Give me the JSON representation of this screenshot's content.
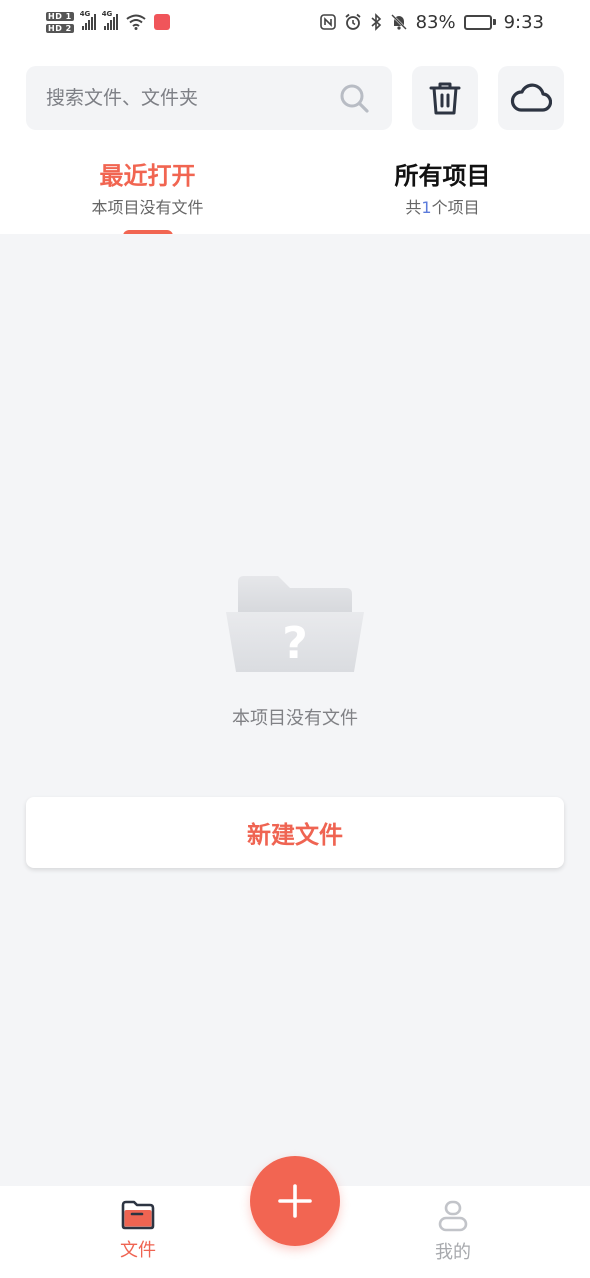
{
  "status_bar": {
    "hd1": "HD 1",
    "hd2": "HD 2",
    "net1": "4G",
    "net2": "4G",
    "battery_percent": "83%",
    "battery_level": 0.83,
    "time": "9:33"
  },
  "search": {
    "placeholder": "搜索文件、文件夹",
    "value": ""
  },
  "toolbar_icons": {
    "search": "search-icon",
    "trash": "trash-icon",
    "cloud": "cloud-icon"
  },
  "tabs": [
    {
      "title": "最近打开",
      "subtitle": "本项目没有文件",
      "active": true
    },
    {
      "title": "所有项目",
      "subtitle_prefix": "共",
      "subtitle_count": "1",
      "subtitle_suffix": "个项目",
      "active": false
    }
  ],
  "empty_state": {
    "icon": "folder-question-icon",
    "message": "本项目没有文件"
  },
  "new_file_button": "新建文件",
  "bottom_nav": [
    {
      "label": "文件",
      "icon": "folder-icon",
      "active": true
    },
    {
      "label": "我的",
      "icon": "user-icon",
      "active": false
    }
  ],
  "fab_icon": "plus-icon",
  "colors": {
    "accent": "#f16551",
    "count_blue": "#5b7bdb",
    "background": "#f4f5f7"
  }
}
